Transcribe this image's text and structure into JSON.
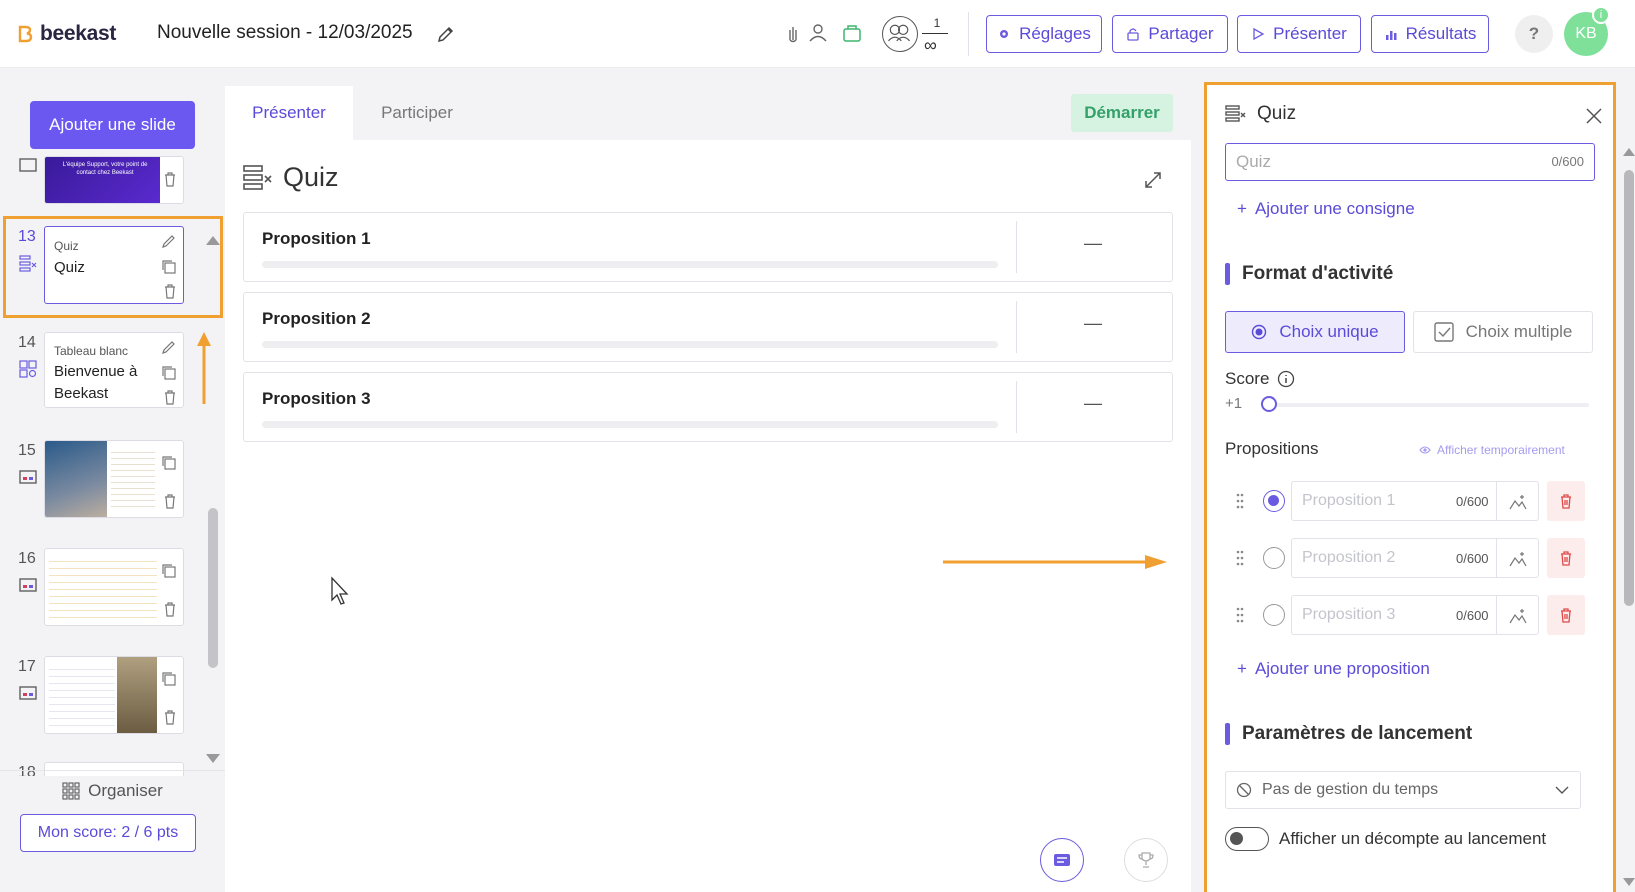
{
  "header": {
    "logo_text": "beekast",
    "session_title": "Nouvelle session - 12/03/2025",
    "participants": {
      "current": "1",
      "max": "∞"
    },
    "buttons": {
      "settings": "Réglages",
      "share": "Partager",
      "present": "Présenter",
      "results": "Résultats"
    },
    "help": "?",
    "avatar": "KB",
    "avatar_badge": "i",
    "accent_color": "#6a5be0"
  },
  "sidebar": {
    "add_slide": "Ajouter une slide",
    "slides": [
      {
        "num": "",
        "type": "",
        "title": "L'équipe Support, votre point de contact chez Beekast"
      },
      {
        "num": "13",
        "type": "Quiz",
        "title": "Quiz"
      },
      {
        "num": "14",
        "type": "Tableau blanc",
        "title": "Bienvenue à Beekast"
      },
      {
        "num": "15",
        "type": "",
        "title": ""
      },
      {
        "num": "16",
        "type": "",
        "title": ""
      },
      {
        "num": "17",
        "type": "",
        "title": ""
      },
      {
        "num": "18",
        "type": "",
        "title": ""
      }
    ],
    "organise": "Organiser",
    "my_score": "Mon score: 2 / 6 pts"
  },
  "main": {
    "tabs": [
      "Présenter",
      "Participer"
    ],
    "start": "Démarrer",
    "title": "Quiz",
    "propositions": [
      {
        "label": "Proposition 1",
        "value": "—"
      },
      {
        "label": "Proposition 2",
        "value": "—"
      },
      {
        "label": "Proposition 3",
        "value": "—"
      }
    ]
  },
  "panel": {
    "title": "Quiz",
    "quiz_input": {
      "placeholder": "Quiz",
      "count": "0/600"
    },
    "add_instruction": "Ajouter une consigne",
    "format_title": "Format d'activité",
    "single_choice": "Choix unique",
    "multiple_choice": "Choix multiple",
    "score_label": "Score",
    "score_value": "+1",
    "score_level": 0,
    "propositions_label": "Propositions",
    "show_temp": "Afficher temporairement",
    "options": [
      {
        "placeholder": "Proposition 1",
        "count": "0/600",
        "selected": true
      },
      {
        "placeholder": "Proposition 2",
        "count": "0/600",
        "selected": false
      },
      {
        "placeholder": "Proposition 3",
        "count": "0/600",
        "selected": false
      }
    ],
    "add_option": "Ajouter une proposition",
    "launch_title": "Paramètres de lancement",
    "timing": "Pas de gestion du temps",
    "countdown": "Afficher un décompte au lancement",
    "countdown_on": false
  },
  "annotation_color": "#f0a030"
}
